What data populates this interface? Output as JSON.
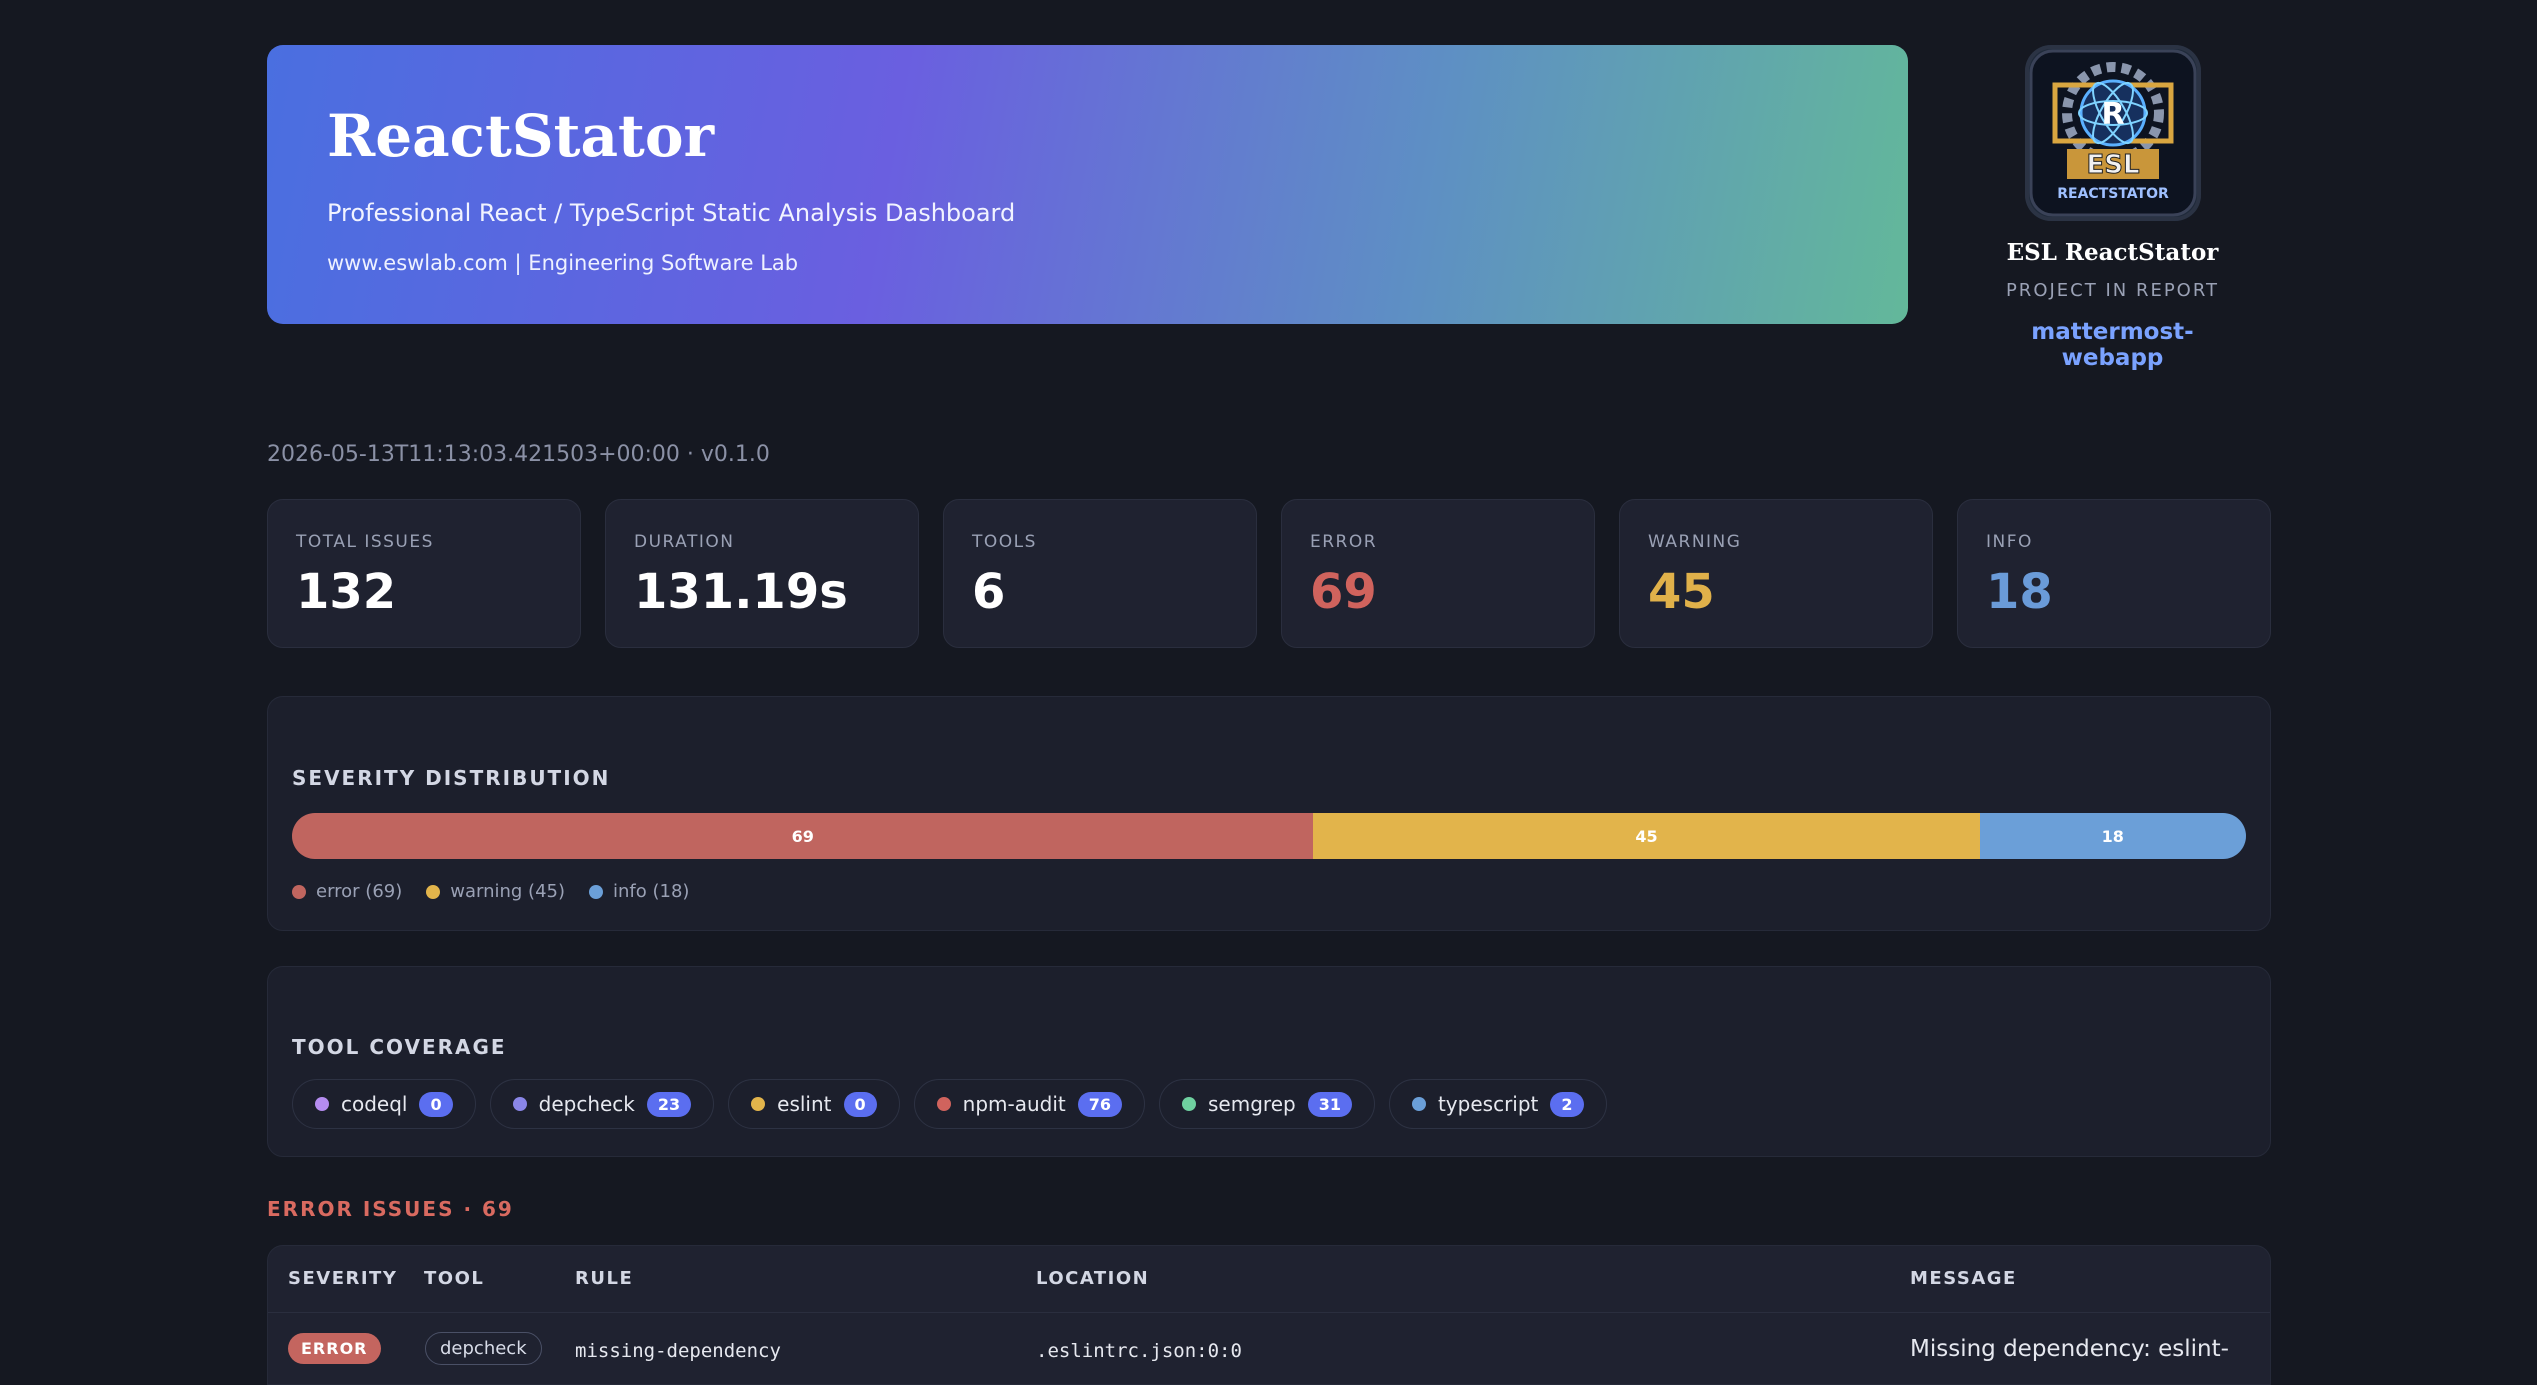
{
  "hero": {
    "title": "ReactStator",
    "subtitle": "Professional React / TypeScript Static Analysis Dashboard",
    "link": "www.eswlab.com | Engineering Software Lab"
  },
  "brand": {
    "logo_text_1": "ESL",
    "logo_text_2": "REACTSTATOR",
    "logo_letter": "R",
    "name": "ESL ReactStator",
    "label": "PROJECT IN REPORT",
    "project": "mattermost-webapp"
  },
  "meta": "2026-05-13T11:13:03.421503+00:00 · v0.1.0",
  "stats": [
    {
      "label": "TOTAL ISSUES",
      "value": "132",
      "color": "#ffffff"
    },
    {
      "label": "DURATION",
      "value": "131.19s",
      "color": "#ffffff"
    },
    {
      "label": "TOOLS",
      "value": "6",
      "color": "#ffffff"
    },
    {
      "label": "ERROR",
      "value": "69",
      "color": "#d0635d"
    },
    {
      "label": "WARNING",
      "value": "45",
      "color": "#e0b14a"
    },
    {
      "label": "INFO",
      "value": "18",
      "color": "#6a9bd8"
    }
  ],
  "severity": {
    "title": "SEVERITY DISTRIBUTION",
    "segments": [
      {
        "label": "69",
        "value": 69,
        "color": "#c0655f"
      },
      {
        "label": "45",
        "value": 45,
        "color": "#e2b44b"
      },
      {
        "label": "18",
        "value": 18,
        "color": "#6b9fd8"
      }
    ],
    "legend": [
      {
        "label": "error (69)",
        "color": "#c0655f"
      },
      {
        "label": "warning (45)",
        "color": "#e2b44b"
      },
      {
        "label": "info (18)",
        "color": "#6b9fd8"
      }
    ]
  },
  "tools": {
    "title": "TOOL COVERAGE",
    "items": [
      {
        "name": "codeql",
        "count": "0",
        "color": "#b58cf0"
      },
      {
        "name": "depcheck",
        "count": "23",
        "color": "#8a86e8"
      },
      {
        "name": "eslint",
        "count": "0",
        "color": "#e2b44b"
      },
      {
        "name": "npm-audit",
        "count": "76",
        "color": "#d0635d"
      },
      {
        "name": "semgrep",
        "count": "31",
        "color": "#6fd0a0"
      },
      {
        "name": "typescript",
        "count": "2",
        "color": "#6b9fd8"
      }
    ]
  },
  "errors": {
    "title": "ERROR ISSUES · 69",
    "columns": [
      "SEVERITY",
      "TOOL",
      "RULE",
      "LOCATION",
      "MESSAGE"
    ],
    "rows": [
      {
        "severity": "ERROR",
        "tool": "depcheck",
        "rule": "missing-dependency",
        "location": ".eslintrc.json:0:0",
        "message": "Missing dependency: eslint-"
      }
    ]
  }
}
